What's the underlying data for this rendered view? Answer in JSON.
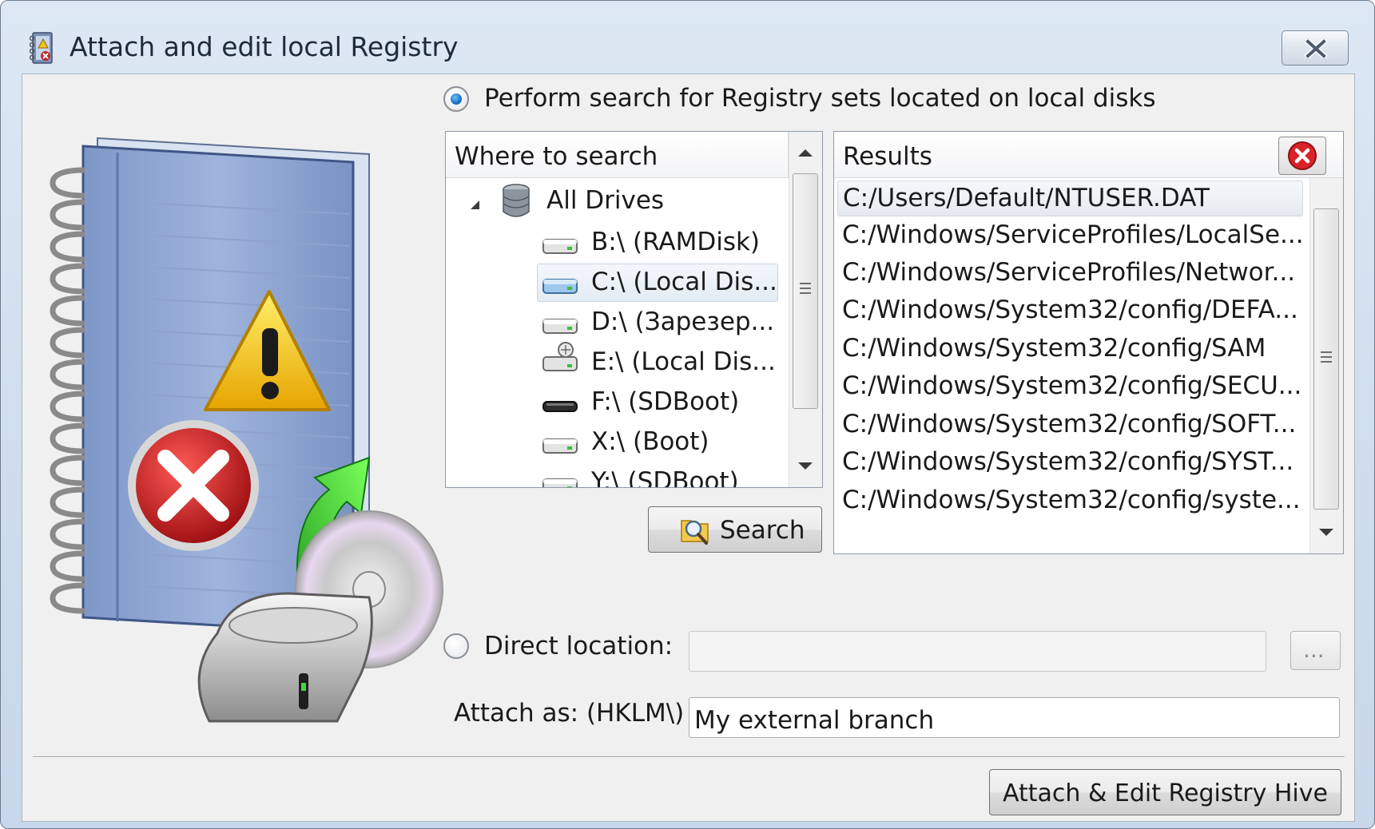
{
  "window": {
    "title": "Attach and edit local Registry"
  },
  "search_mode": {
    "label": "Perform search for Registry sets located on local disks",
    "selected": true
  },
  "tree": {
    "header": "Where to search",
    "root": {
      "label": "All Drives",
      "icon": "database-icon",
      "expanded": true
    },
    "drives": [
      {
        "label": "B:\\  (RAMDisk)",
        "icon": "hard-drive-icon"
      },
      {
        "label": "C:\\  (Local Dis...",
        "icon": "hard-drive-blue-icon",
        "selected": true
      },
      {
        "label": "D:\\  (Зарезер...",
        "icon": "hard-drive-icon"
      },
      {
        "label": "E:\\  (Local Dis...",
        "icon": "system-drive-icon"
      },
      {
        "label": "F:\\  (SDBoot)",
        "icon": "removable-drive-icon"
      },
      {
        "label": "X:\\  (Boot)",
        "icon": "hard-drive-icon"
      },
      {
        "label": "Y:\\  (SDBoot)",
        "icon": "hard-drive-icon"
      }
    ]
  },
  "search_button": {
    "label": "Search",
    "icon": "search-folder-icon"
  },
  "results": {
    "header": "Results",
    "clear_icon": "clear-red-x-icon",
    "items": [
      "C:/Users/Default/NTUSER.DAT",
      "C:/Windows/ServiceProfiles/LocalSe...",
      "C:/Windows/ServiceProfiles/Networ...",
      "C:/Windows/System32/config/DEFA...",
      "C:/Windows/System32/config/SAM",
      "C:/Windows/System32/config/SECU...",
      "C:/Windows/System32/config/SOFT...",
      "C:/Windows/System32/config/SYST...",
      "C:/Windows/System32/config/syste..."
    ],
    "selected_index": 0
  },
  "direct_location": {
    "label": "Direct location:",
    "value": "",
    "selected": false,
    "browse_label": "..."
  },
  "attach_as": {
    "label": "Attach as:  (HKLM\\)",
    "value": "My external branch"
  },
  "attach_button": {
    "label": "Attach & Edit Registry Hive"
  }
}
